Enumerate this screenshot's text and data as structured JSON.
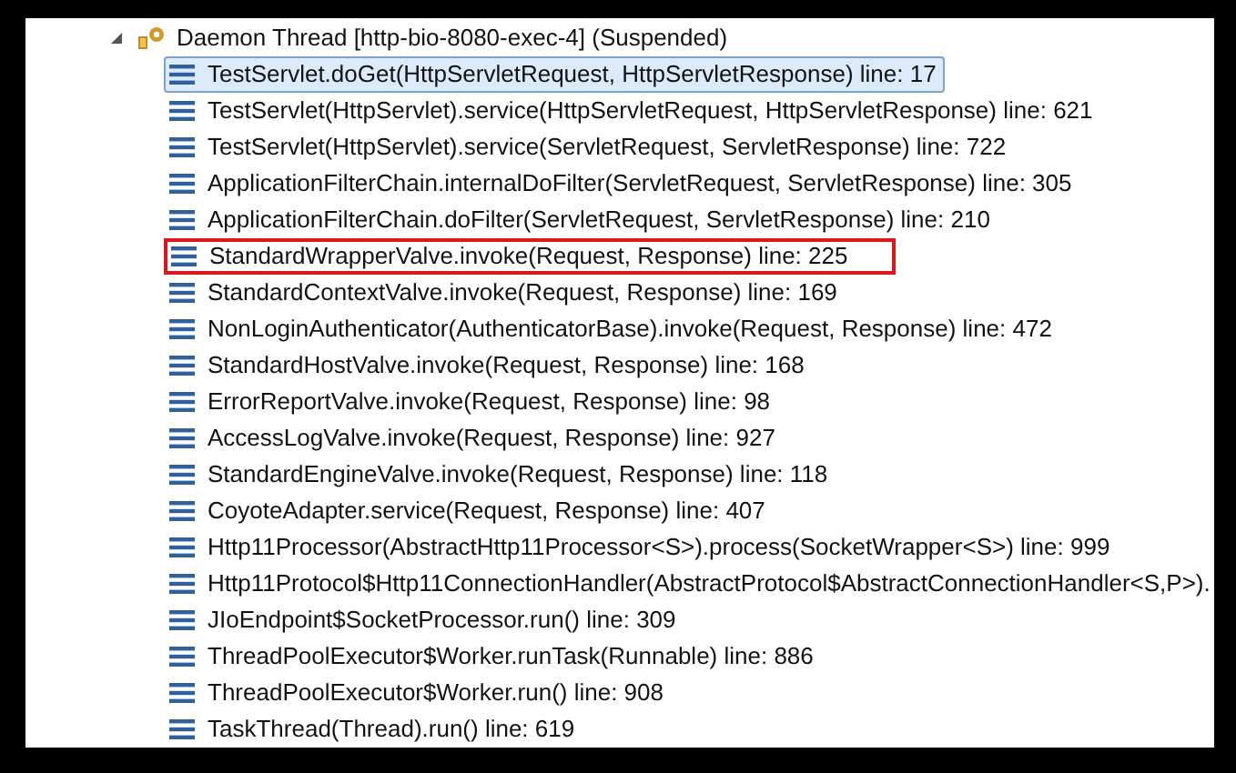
{
  "thread": {
    "label": "Daemon Thread [http-bio-8080-exec-4] (Suspended)",
    "expanded": true
  },
  "frames": [
    {
      "text": "TestServlet.doGet(HttpServletRequest, HttpServletResponse) line: 17",
      "selected": true,
      "marked": false
    },
    {
      "text": "TestServlet(HttpServlet).service(HttpServletRequest, HttpServletResponse) line: 621",
      "selected": false,
      "marked": false
    },
    {
      "text": "TestServlet(HttpServlet).service(ServletRequest, ServletResponse) line: 722",
      "selected": false,
      "marked": false
    },
    {
      "text": "ApplicationFilterChain.internalDoFilter(ServletRequest, ServletResponse) line: 305",
      "selected": false,
      "marked": false
    },
    {
      "text": "ApplicationFilterChain.doFilter(ServletRequest, ServletResponse) line: 210",
      "selected": false,
      "marked": false
    },
    {
      "text": "StandardWrapperValve.invoke(Request, Response) line: 225",
      "selected": false,
      "marked": true
    },
    {
      "text": "StandardContextValve.invoke(Request, Response) line: 169",
      "selected": false,
      "marked": false
    },
    {
      "text": "NonLoginAuthenticator(AuthenticatorBase).invoke(Request, Response) line: 472",
      "selected": false,
      "marked": false
    },
    {
      "text": "StandardHostValve.invoke(Request, Response) line: 168",
      "selected": false,
      "marked": false
    },
    {
      "text": "ErrorReportValve.invoke(Request, Response) line: 98",
      "selected": false,
      "marked": false
    },
    {
      "text": "AccessLogValve.invoke(Request, Response) line: 927",
      "selected": false,
      "marked": false
    },
    {
      "text": "StandardEngineValve.invoke(Request, Response) line: 118",
      "selected": false,
      "marked": false
    },
    {
      "text": "CoyoteAdapter.service(Request, Response) line: 407",
      "selected": false,
      "marked": false
    },
    {
      "text": "Http11Processor(AbstractHttp11Processor<S>).process(SocketWrapper<S>) line: 999",
      "selected": false,
      "marked": false
    },
    {
      "text": "Http11Protocol$Http11ConnectionHandler(AbstractProtocol$AbstractConnectionHandler<S,P>).",
      "selected": false,
      "marked": false
    },
    {
      "text": "JIoEndpoint$SocketProcessor.run() line: 309",
      "selected": false,
      "marked": false
    },
    {
      "text": "ThreadPoolExecutor$Worker.runTask(Runnable) line: 886",
      "selected": false,
      "marked": false
    },
    {
      "text": "ThreadPoolExecutor$Worker.run() line: 908",
      "selected": false,
      "marked": false
    },
    {
      "text": "TaskThread(Thread).run() line: 619",
      "selected": false,
      "marked": false
    }
  ]
}
